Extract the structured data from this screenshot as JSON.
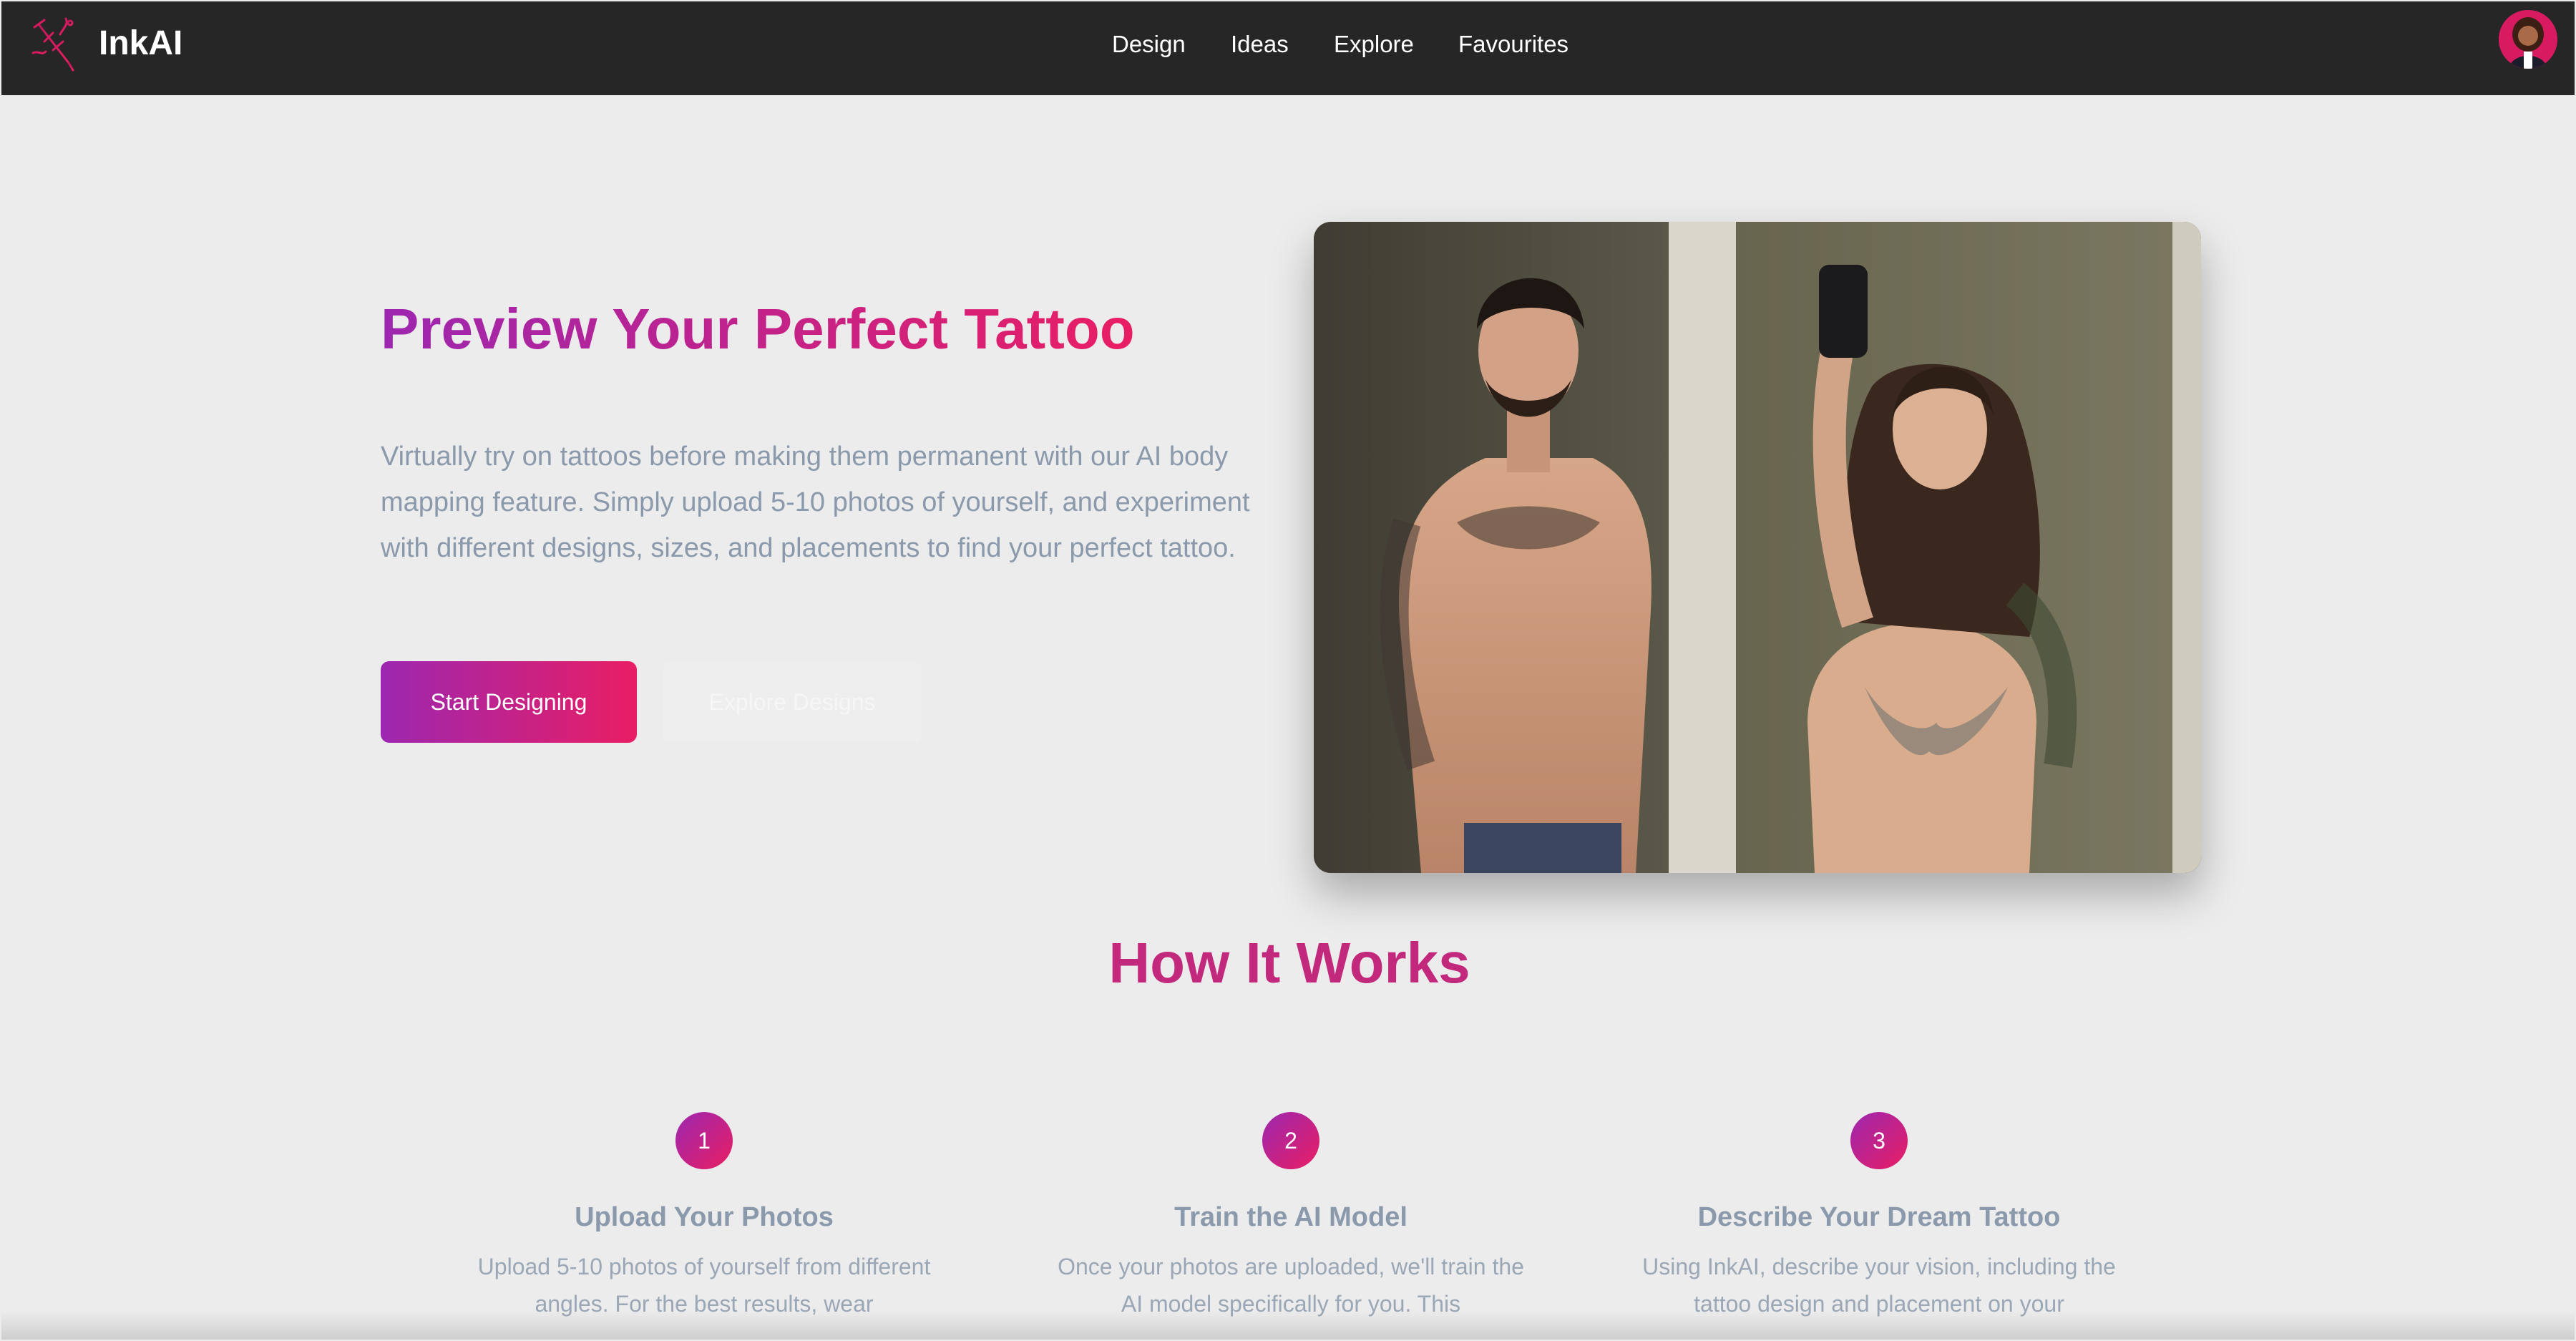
{
  "brand": {
    "name": "InkAI",
    "icon": "tattoo-needle-icon",
    "accent_start": "#9c27b0",
    "accent_end": "#e91e63"
  },
  "nav": {
    "items": [
      {
        "label": "Design"
      },
      {
        "label": "Ideas"
      },
      {
        "label": "Explore"
      },
      {
        "label": "Favourites"
      }
    ]
  },
  "user": {
    "avatar": "user-avatar-icon"
  },
  "hero": {
    "title": "Preview Your Perfect Tattoo",
    "description": "Virtually try on tattoos before making them permanent with our AI body mapping feature. Simply upload 5-10 photos of yourself, and experiment with different designs, sizes, and placements to find your perfect tattoo.",
    "primary_button": "Start Designing",
    "secondary_button": "Explore Designs"
  },
  "how_it_works": {
    "title": "How It Works",
    "steps": [
      {
        "number": "1",
        "title": "Upload Your Photos",
        "text": "Upload 5-10 photos of yourself from different angles. For the best results, wear"
      },
      {
        "number": "2",
        "title": "Train the AI Model",
        "text": "Once your photos are uploaded, we'll train the AI model specifically for you. This"
      },
      {
        "number": "3",
        "title": "Describe Your Dream Tattoo",
        "text": "Using InkAI, describe your vision, including the tattoo design and placement on your"
      }
    ]
  }
}
